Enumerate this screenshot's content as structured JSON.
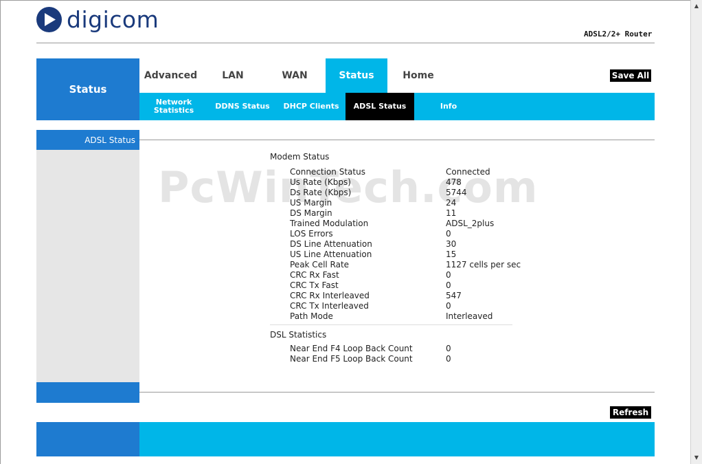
{
  "brand": {
    "name": "digicom",
    "product": "ADSL2/2+ Router"
  },
  "watermark": "PcWinTech.com",
  "section_label": "Status",
  "main_tabs": [
    {
      "label": "Advanced",
      "active": false
    },
    {
      "label": "LAN",
      "active": false
    },
    {
      "label": "WAN",
      "active": false
    },
    {
      "label": "Status",
      "active": true
    },
    {
      "label": "Home",
      "active": false
    }
  ],
  "save_all_label": "Save All",
  "sub_tabs": [
    {
      "label": "Network Statistics",
      "active": false
    },
    {
      "label": "DDNS Status",
      "active": false
    },
    {
      "label": "DHCP Clients",
      "active": false
    },
    {
      "label": "ADSL Status",
      "active": true
    },
    {
      "label": "Info",
      "active": false
    }
  ],
  "sidebar": {
    "label": "ADSL Status"
  },
  "modem_status": {
    "title": "Modem Status",
    "rows": [
      {
        "label": "Connection Status",
        "value": "Connected"
      },
      {
        "label": "Us Rate (Kbps)",
        "value": "478"
      },
      {
        "label": "Ds Rate (Kbps)",
        "value": "5744"
      },
      {
        "label": "US Margin",
        "value": "24"
      },
      {
        "label": "DS Margin",
        "value": "11"
      },
      {
        "label": "Trained Modulation",
        "value": "ADSL_2plus"
      },
      {
        "label": "LOS Errors",
        "value": "0"
      },
      {
        "label": "DS Line Attenuation",
        "value": "30"
      },
      {
        "label": "US Line Attenuation",
        "value": "15"
      },
      {
        "label": "Peak Cell Rate",
        "value": "1127 cells per sec"
      },
      {
        "label": "CRC Rx Fast",
        "value": "0"
      },
      {
        "label": "CRC Tx Fast",
        "value": "0"
      },
      {
        "label": "CRC Rx Interleaved",
        "value": "547"
      },
      {
        "label": "CRC Tx Interleaved",
        "value": "0"
      },
      {
        "label": "Path Mode",
        "value": "Interleaved"
      }
    ]
  },
  "dsl_statistics": {
    "title": "DSL Statistics",
    "rows": [
      {
        "label": "Near End F4 Loop Back Count",
        "value": "0"
      },
      {
        "label": "Near End F5 Loop Back Count",
        "value": "0"
      }
    ]
  },
  "refresh_label": "Refresh",
  "colors": {
    "primary_blue": "#1e7bd0",
    "cyan": "#00b6e8",
    "logo_navy": "#1a3a7c"
  }
}
